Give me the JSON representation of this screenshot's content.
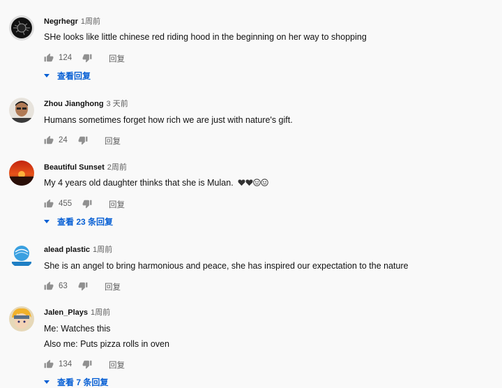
{
  "comments": [
    {
      "author": "Negrhegr",
      "time": "1周前",
      "text": "SHe looks like little chinese red riding hood in the beginning on her way to shopping",
      "likes": "124",
      "reply_label": "回复",
      "view_replies": "查看回复"
    },
    {
      "author": "Zhou Jianghong",
      "time": "3 天前",
      "text": "Humans sometimes forget how rich we are just with nature's gift.",
      "likes": "24",
      "reply_label": "回复"
    },
    {
      "author": "Beautiful Sunset",
      "time": "2周前",
      "text": "My 4 years old daughter thinks that she is Mulan.",
      "emoji": [
        "black-heart",
        "black-heart",
        "smiling-face",
        "smiling-face"
      ],
      "likes": "455",
      "reply_label": "回复",
      "view_replies": "查看 23 条回复"
    },
    {
      "author": "alead plastic",
      "time": "1周前",
      "text": "She is an angel to bring harmonious and peace, she has inspired our expectation to the nature",
      "likes": "63",
      "reply_label": "回复"
    },
    {
      "author": "Jalen_Plays",
      "time": "1周前",
      "text_lines": [
        "Me: Watches this",
        "Also me: Puts pizza rolls in oven"
      ],
      "likes": "134",
      "reply_label": "回复",
      "view_replies": "查看 7 条回复"
    }
  ],
  "colors": {
    "link": "#065fd4",
    "meta": "#606060",
    "background": "#f9f9f9"
  },
  "icons": [
    "thumbs-up-icon",
    "thumbs-down-icon",
    "caret-down-icon"
  ]
}
